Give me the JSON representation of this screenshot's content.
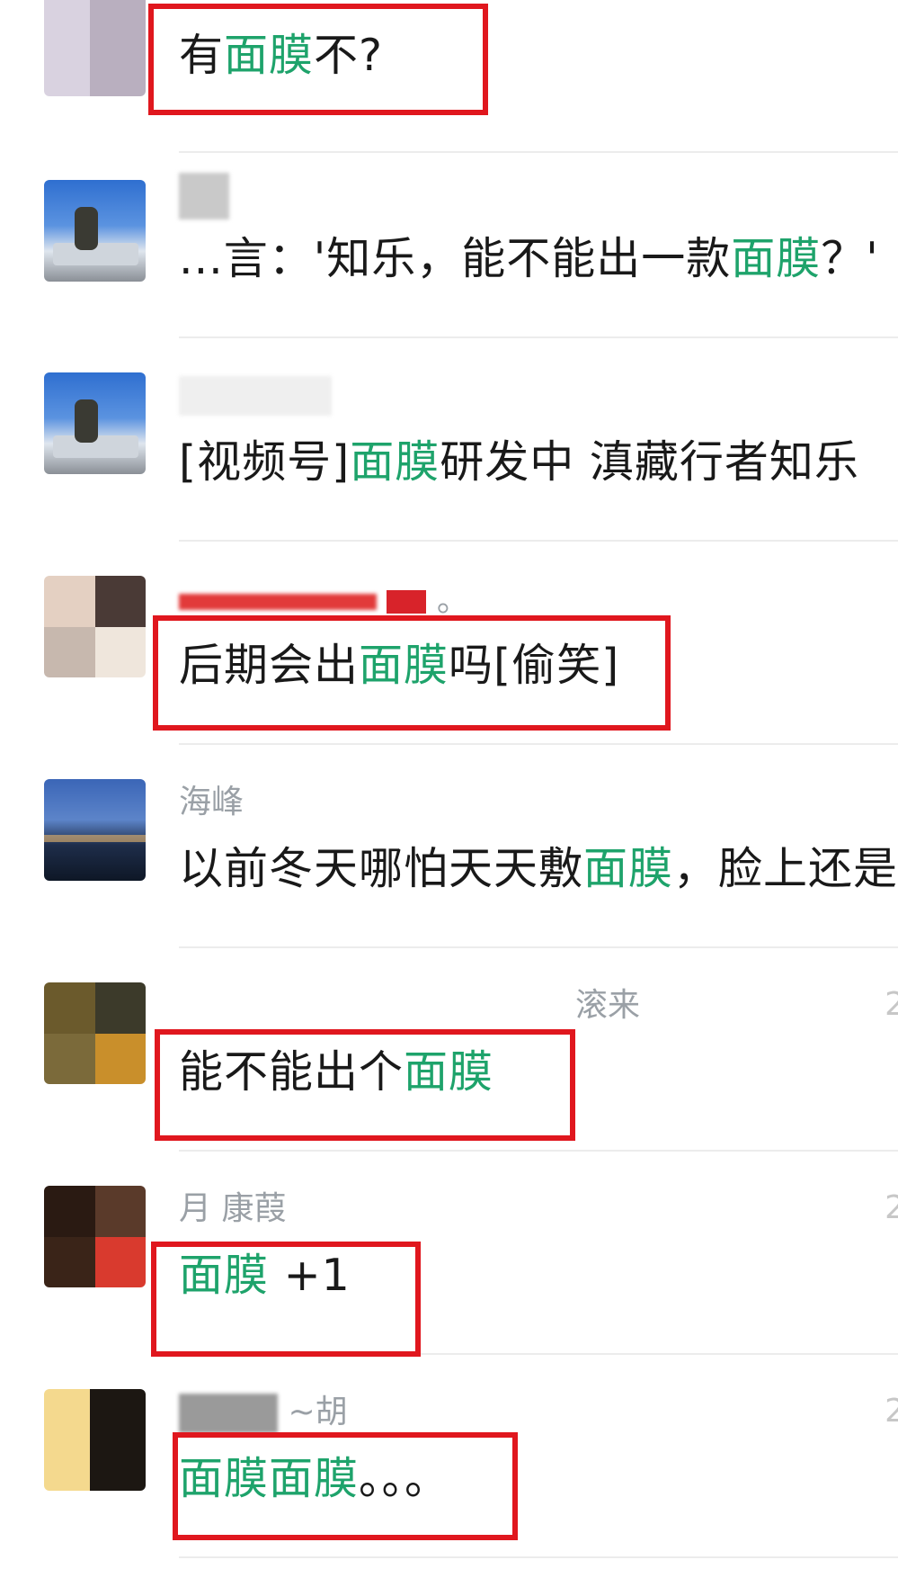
{
  "comments": [
    {
      "id": "c1",
      "name": "",
      "message": [
        {
          "t": "有",
          "h": false
        },
        {
          "t": "面膜",
          "h": true
        },
        {
          "t": "不?",
          "h": false
        }
      ],
      "boxed": true
    },
    {
      "id": "c2",
      "name": "",
      "message": [
        {
          "t": "...言：'知乐，能不能出一款",
          "h": false
        },
        {
          "t": "面膜",
          "h": true
        },
        {
          "t": "？'",
          "h": false
        }
      ],
      "boxed": false
    },
    {
      "id": "c3",
      "name": "",
      "message": [
        {
          "t": "[视频号]",
          "h": false
        },
        {
          "t": "面膜",
          "h": true
        },
        {
          "t": "研发中 滇藏行者知乐",
          "h": false
        }
      ],
      "boxed": false
    },
    {
      "id": "c4",
      "name": "。",
      "message": [
        {
          "t": "后期会出",
          "h": false
        },
        {
          "t": "面膜",
          "h": true
        },
        {
          "t": "吗[偷笑]",
          "h": false
        }
      ],
      "boxed": true
    },
    {
      "id": "c5",
      "name": "海峰",
      "message": [
        {
          "t": "以前冬天哪怕天天敷",
          "h": false
        },
        {
          "t": "面膜",
          "h": true
        },
        {
          "t": "，脸上还是",
          "h": false
        }
      ],
      "boxed": false
    },
    {
      "id": "c6",
      "name": "滚来",
      "message": [
        {
          "t": "能不能出个",
          "h": false
        },
        {
          "t": "面膜",
          "h": true
        }
      ],
      "boxed": true,
      "time": "2"
    },
    {
      "id": "c7",
      "name": "月 康葭",
      "message": [
        {
          "t": "面膜",
          "h": true
        },
        {
          "t": " +1",
          "h": false
        }
      ],
      "boxed": true,
      "time": "2"
    },
    {
      "id": "c8",
      "name": "~胡",
      "message": [
        {
          "t": "面膜面膜",
          "h": true
        },
        {
          "t": "。。。",
          "h": false
        }
      ],
      "boxed": true,
      "time": "2"
    }
  ],
  "colors": {
    "highlight": "#1ea36b",
    "annotation": "#e0171e",
    "text": "#191919",
    "name": "#9aa0a6"
  }
}
